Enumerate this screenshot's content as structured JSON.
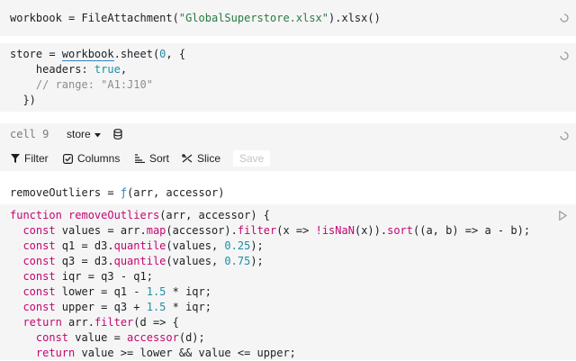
{
  "cell1": {
    "code": [
      {
        "t": "workbook = FileAttachment(",
        "c": "plain"
      },
      {
        "t": "\"GlobalSuperstore.xlsx\"",
        "c": "str"
      },
      {
        "t": ").xlsx()",
        "c": "plain"
      }
    ]
  },
  "cell2": {
    "lines": [
      [
        {
          "t": "store = ",
          "c": "plain"
        },
        {
          "t": "workbook",
          "c": "ref"
        },
        {
          "t": ".sheet(",
          "c": "plain"
        },
        {
          "t": "0",
          "c": "num"
        },
        {
          "t": ", {",
          "c": "plain"
        }
      ],
      [
        {
          "t": "    headers: ",
          "c": "plain"
        },
        {
          "t": "true",
          "c": "num"
        },
        {
          "t": ",",
          "c": "plain"
        }
      ],
      [
        {
          "t": "    // range: \"A1:J10\"",
          "c": "cmt"
        }
      ],
      [
        {
          "t": "  })",
          "c": "plain"
        }
      ]
    ]
  },
  "cell3": {
    "label": "cell 9",
    "selected_table": "store",
    "toolbar": {
      "filter": "Filter",
      "columns": "Columns",
      "sort": "Sort",
      "slice": "Slice",
      "save": "Save"
    }
  },
  "cell4": {
    "output": [
      {
        "t": "removeOutliers = ",
        "c": "plain"
      },
      {
        "t": "ƒ",
        "c": "fn"
      },
      {
        "t": "(arr, accessor)",
        "c": "plain"
      }
    ]
  },
  "cell5": {
    "lines": [
      [
        {
          "t": "function ",
          "c": "kw"
        },
        {
          "t": "removeOutliers",
          "c": "kw"
        },
        {
          "t": "(arr, accessor) {",
          "c": "plain"
        }
      ],
      [
        {
          "t": "  const ",
          "c": "kw"
        },
        {
          "t": "values = arr.",
          "c": "plain"
        },
        {
          "t": "map",
          "c": "kw"
        },
        {
          "t": "(accessor).",
          "c": "plain"
        },
        {
          "t": "filter",
          "c": "kw"
        },
        {
          "t": "(x => ",
          "c": "plain"
        },
        {
          "t": "!isNaN",
          "c": "kw"
        },
        {
          "t": "(x)).",
          "c": "plain"
        },
        {
          "t": "sort",
          "c": "kw"
        },
        {
          "t": "((a, b) => a - b);",
          "c": "plain"
        }
      ],
      [
        {
          "t": "  const ",
          "c": "kw"
        },
        {
          "t": "q1 = d3.",
          "c": "plain"
        },
        {
          "t": "quantile",
          "c": "kw"
        },
        {
          "t": "(values, ",
          "c": "plain"
        },
        {
          "t": "0.25",
          "c": "num"
        },
        {
          "t": ");",
          "c": "plain"
        }
      ],
      [
        {
          "t": "  const ",
          "c": "kw"
        },
        {
          "t": "q3 = d3.",
          "c": "plain"
        },
        {
          "t": "quantile",
          "c": "kw"
        },
        {
          "t": "(values, ",
          "c": "plain"
        },
        {
          "t": "0.75",
          "c": "num"
        },
        {
          "t": ");",
          "c": "plain"
        }
      ],
      [
        {
          "t": "  const ",
          "c": "kw"
        },
        {
          "t": "iqr = q3 - q1;",
          "c": "plain"
        }
      ],
      [
        {
          "t": "  const ",
          "c": "kw"
        },
        {
          "t": "lower = q1 - ",
          "c": "plain"
        },
        {
          "t": "1.5",
          "c": "num"
        },
        {
          "t": " * iqr;",
          "c": "plain"
        }
      ],
      [
        {
          "t": "  const ",
          "c": "kw"
        },
        {
          "t": "upper = q3 + ",
          "c": "plain"
        },
        {
          "t": "1.5",
          "c": "num"
        },
        {
          "t": " * iqr;",
          "c": "plain"
        }
      ],
      [
        {
          "t": "  return ",
          "c": "kw"
        },
        {
          "t": "arr.",
          "c": "plain"
        },
        {
          "t": "filter",
          "c": "kw"
        },
        {
          "t": "(d => {",
          "c": "plain"
        }
      ],
      [
        {
          "t": "    const ",
          "c": "kw"
        },
        {
          "t": "value = ",
          "c": "plain"
        },
        {
          "t": "accessor",
          "c": "kw"
        },
        {
          "t": "(d);",
          "c": "plain"
        }
      ],
      [
        {
          "t": "    return ",
          "c": "kw"
        },
        {
          "t": "value >= lower && value <= upper;",
          "c": "plain"
        }
      ]
    ]
  },
  "colors": {
    "keyword": "#c30771",
    "function_ref": "#3182bd",
    "string": "#2a7a3d",
    "number": "#1d8ea6",
    "comment": "#8c8c8c",
    "cell_bg": "#f5f5f5"
  },
  "icons": [
    "spinner-icon",
    "chevron-down-icon",
    "database-icon",
    "filter-icon",
    "checkbox-icon",
    "sort-icon",
    "slice-icon",
    "play-icon"
  ]
}
